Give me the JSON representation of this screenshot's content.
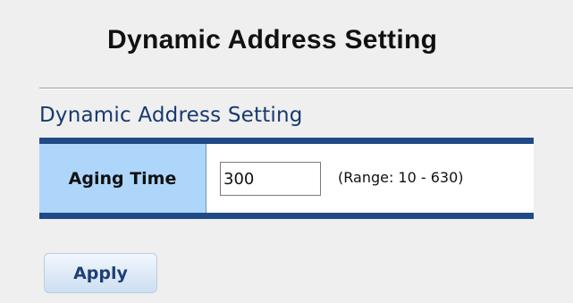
{
  "page": {
    "title": "Dynamic Address Setting"
  },
  "section": {
    "title": "Dynamic Address Setting"
  },
  "aging_time": {
    "label": "Aging Time",
    "value": "300",
    "range_hint": "(Range: 10 - 630)"
  },
  "actions": {
    "apply_label": "Apply"
  },
  "colors": {
    "section_title": "#173a6e",
    "table_border": "#1f4a88",
    "label_cell_bg": "#aed6fb",
    "apply_text": "#1d3f73"
  }
}
